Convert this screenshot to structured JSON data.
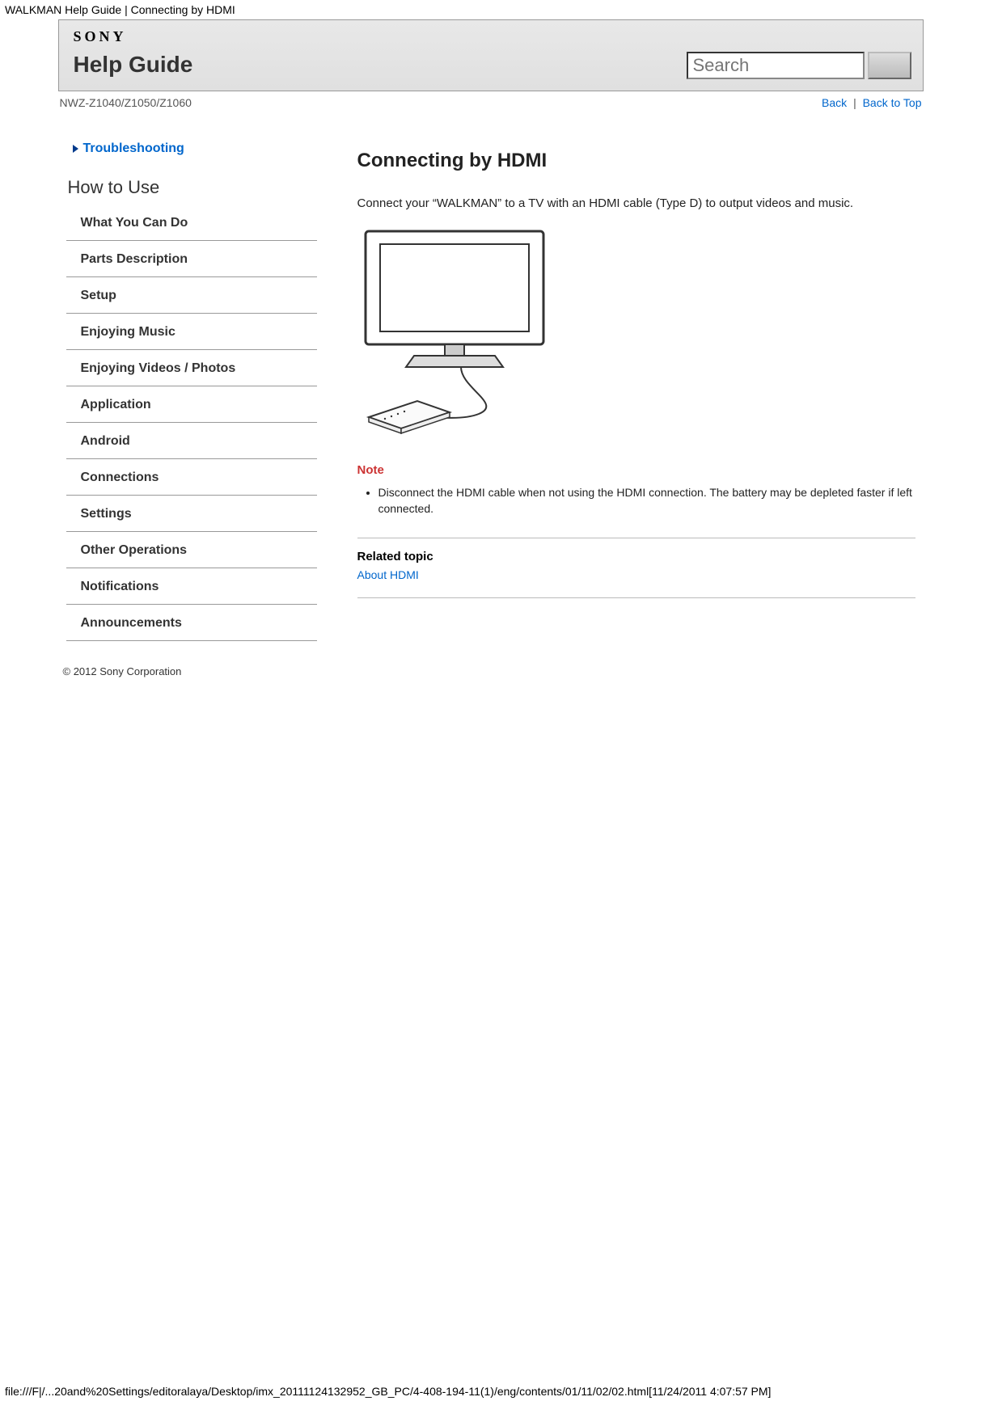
{
  "browser_title": "WALKMAN Help Guide | Connecting by HDMI",
  "header": {
    "logo_text": "SONY",
    "title": "Help Guide",
    "search_placeholder": "Search"
  },
  "subheader": {
    "model": "NWZ-Z1040/Z1050/Z1060",
    "back_label": "Back",
    "top_label": "Back to Top"
  },
  "sidebar": {
    "troubleshooting_label": "Troubleshooting",
    "howto_title": "How to Use",
    "items": [
      "What You Can Do",
      "Parts Description",
      "Setup",
      "Enjoying Music",
      "Enjoying Videos / Photos",
      "Application",
      "Android",
      "Connections",
      "Settings",
      "Other Operations",
      "Notifications",
      "Announcements"
    ]
  },
  "article": {
    "title": "Connecting by HDMI",
    "paragraph": "Connect your “WALKMAN” to a TV with an HDMI cable (Type D) to output videos and music.",
    "note_label": "Note",
    "note_items": [
      "Disconnect the HDMI cable when not using the HDMI connection. The battery may be depleted faster if left connected."
    ],
    "related_label": "Related topic",
    "related_link": "About HDMI"
  },
  "copyright": "© 2012 Sony Corporation",
  "footer_path": "file:///F|/...20and%20Settings/editoralaya/Desktop/imx_20111124132952_GB_PC/4-408-194-11(1)/eng/contents/01/11/02/02.html[11/24/2011 4:07:57 PM]"
}
